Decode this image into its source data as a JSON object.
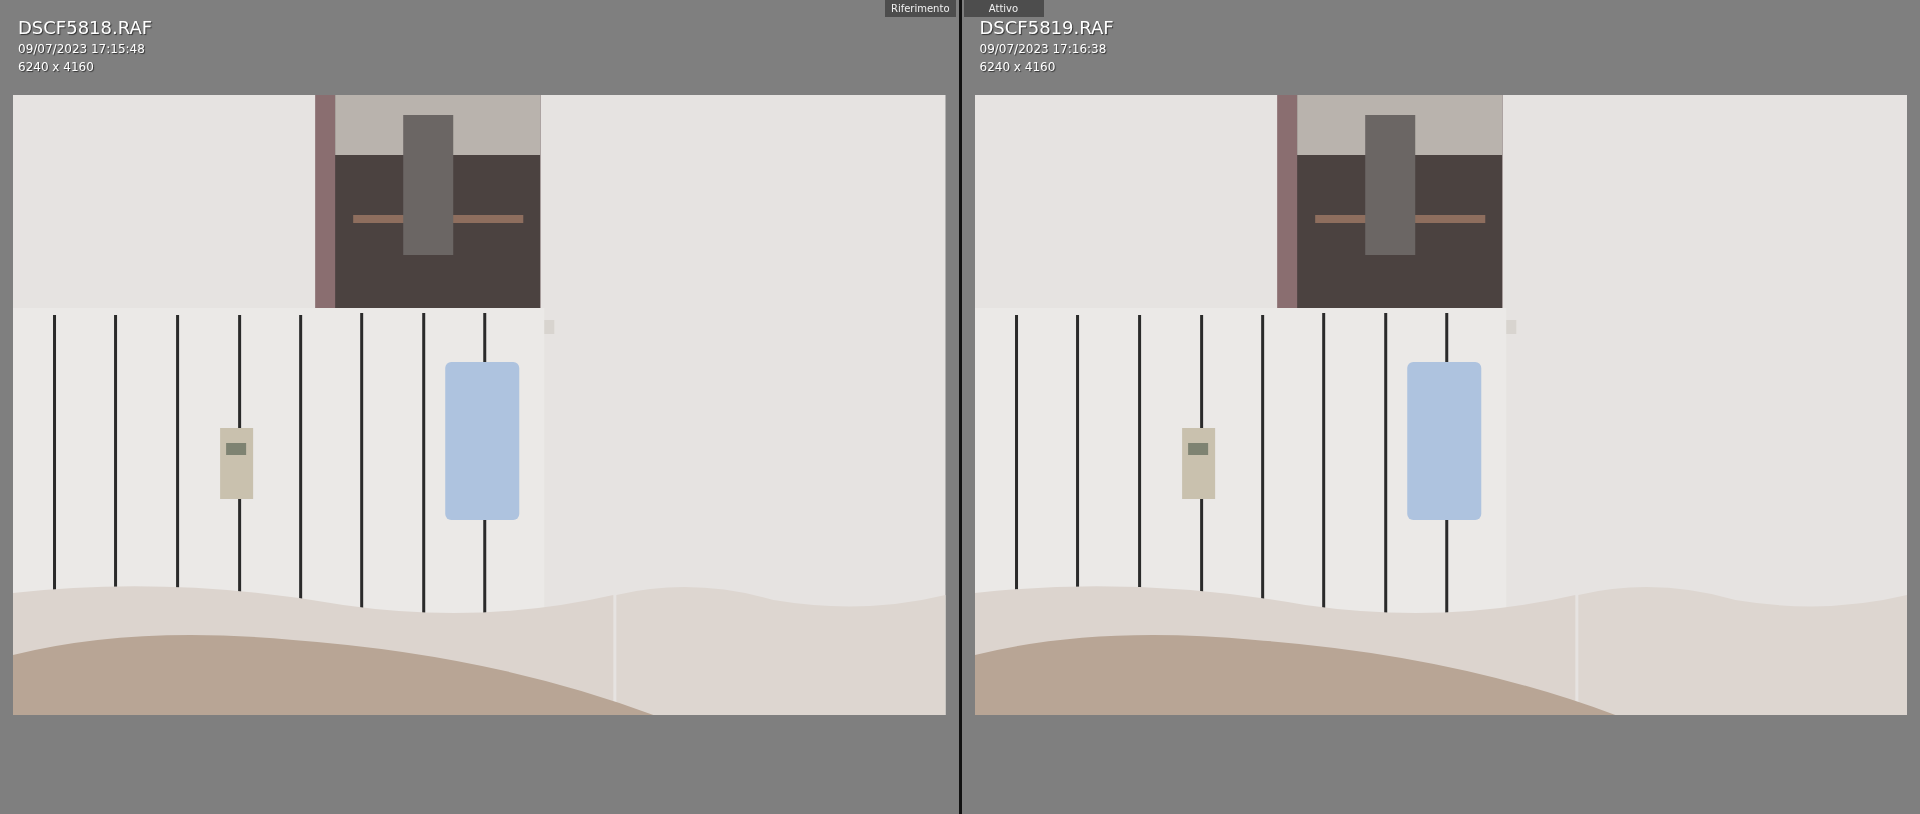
{
  "panels": [
    {
      "label": "Riferimento",
      "filename": "DSCF5818.RAF",
      "datetime": "09/07/2023 17:15:48",
      "dimensions": "6240 x 4160"
    },
    {
      "label": "Attivo",
      "filename": "DSCF5819.RAF",
      "datetime": "09/07/2023 17:16:38",
      "dimensions": "6240 x 4160"
    }
  ]
}
